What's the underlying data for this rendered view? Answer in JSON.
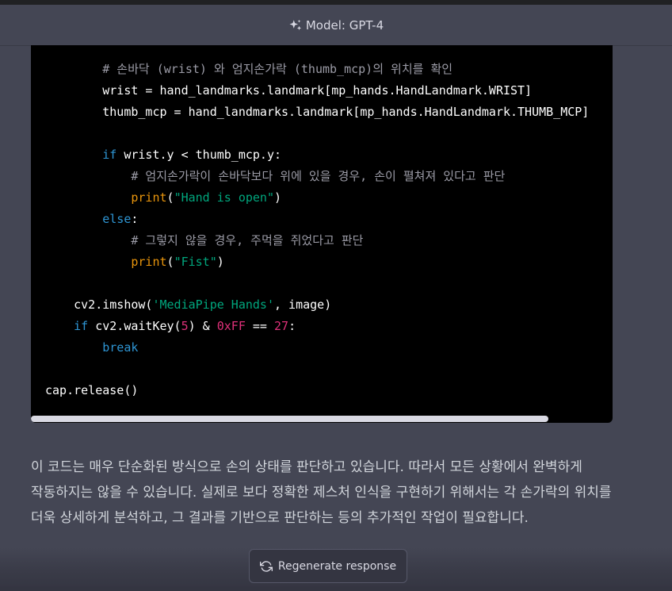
{
  "header": {
    "model_label": "Model: GPT-4",
    "icon": "sparkle-icon"
  },
  "code": {
    "language": "python",
    "lines": [
      [
        {
          "t": "        "
        },
        {
          "t": "# 손바닥 (wrist) 와 엄지손가락 (thumb_mcp)의 위치를 확인",
          "c": "comment"
        }
      ],
      [
        {
          "t": "        wrist = hand_landmarks.landmark[mp_hands.HandLandmark.WRIST]"
        }
      ],
      [
        {
          "t": "        thumb_mcp = hand_landmarks.landmark[mp_hands.HandLandmark.THUMB_MCP]"
        }
      ],
      [
        {
          "t": ""
        }
      ],
      [
        {
          "t": "        "
        },
        {
          "t": "if",
          "c": "keyword"
        },
        {
          "t": " wrist.y < thumb_mcp.y:"
        }
      ],
      [
        {
          "t": "            "
        },
        {
          "t": "# 엄지손가락이 손바닥보다 위에 있을 경우, 손이 펼쳐져 있다고 판단",
          "c": "comment"
        }
      ],
      [
        {
          "t": "            "
        },
        {
          "t": "print",
          "c": "builtin"
        },
        {
          "t": "("
        },
        {
          "t": "\"Hand is open\"",
          "c": "string"
        },
        {
          "t": ")"
        }
      ],
      [
        {
          "t": "        "
        },
        {
          "t": "else",
          "c": "keyword"
        },
        {
          "t": ":"
        }
      ],
      [
        {
          "t": "            "
        },
        {
          "t": "# 그렇지 않을 경우, 주먹을 쥐었다고 판단",
          "c": "comment"
        }
      ],
      [
        {
          "t": "            "
        },
        {
          "t": "print",
          "c": "builtin"
        },
        {
          "t": "("
        },
        {
          "t": "\"Fist\"",
          "c": "string"
        },
        {
          "t": ")"
        }
      ],
      [
        {
          "t": ""
        }
      ],
      [
        {
          "t": "    cv2.imshow("
        },
        {
          "t": "'MediaPipe Hands'",
          "c": "string"
        },
        {
          "t": ", image)"
        }
      ],
      [
        {
          "t": "    "
        },
        {
          "t": "if",
          "c": "keyword"
        },
        {
          "t": " cv2.waitKey("
        },
        {
          "t": "5",
          "c": "number"
        },
        {
          "t": ") & "
        },
        {
          "t": "0xFF",
          "c": "number"
        },
        {
          "t": " == "
        },
        {
          "t": "27",
          "c": "number"
        },
        {
          "t": ":"
        }
      ],
      [
        {
          "t": "        "
        },
        {
          "t": "break",
          "c": "keyword"
        }
      ],
      [
        {
          "t": ""
        }
      ],
      [
        {
          "t": "cap.release()"
        }
      ]
    ],
    "horizontal_scroll_fraction": 0.89
  },
  "answer": {
    "text": "이 코드는 매우 단순화된 방식으로 손의 상태를 판단하고 있습니다. 따라서 모든 상황에서 완벽하게 작동하지는 않을 수 있습니다. 실제로 보다 정확한 제스처 인식을 구현하기 위해서는 각 손가락의 위치를 더욱 상세하게 분석하고, 그 결과를 기반으로 판단하는 등의 추가적인 작업이 필요합니다."
  },
  "regenerate": {
    "label": "Regenerate response",
    "icon": "refresh-icon"
  },
  "colors": {
    "background": "#444654",
    "code_background": "#000000",
    "comment": "#9b9ba6",
    "keyword": "#2e95d3",
    "builtin": "#e9950c",
    "string": "#00a67d",
    "number": "#df3079"
  }
}
